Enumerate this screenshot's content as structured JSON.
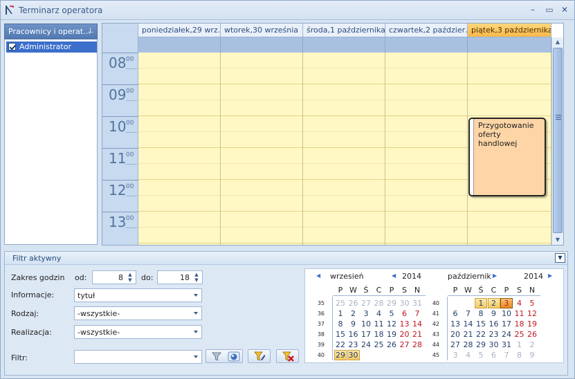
{
  "window": {
    "title": "Terminarz operatora"
  },
  "left_panel": {
    "header": "Pracownicy i operat…",
    "operators": [
      {
        "name": "Administrator",
        "checked": true
      }
    ]
  },
  "scheduler": {
    "days": [
      {
        "label": "poniedziałek,29 wrz…"
      },
      {
        "label": "wtorek,30 września"
      },
      {
        "label": "środa,1 października"
      },
      {
        "label": "czwartek,2 paździer…"
      },
      {
        "label": "piątek,3 października",
        "today": true
      }
    ],
    "hours": [
      "08",
      "09",
      "10",
      "11",
      "12",
      "13"
    ],
    "minutes_label": "00",
    "appointment": {
      "text": "Przygotowanie oferty handlowej",
      "day": "piątek,3 października"
    }
  },
  "filter": {
    "title": "Filtr aktywny",
    "hour_range_label": "Zakres godzin",
    "from_label": "od:",
    "from_value": "8",
    "to_label": "do:",
    "to_value": "18",
    "info_label": "Informacje:",
    "info_value": "tytuł",
    "type_label": "Rodzaj:",
    "type_value": "-wszystkie-",
    "realization_label": "Realizacja:",
    "realization_value": "-wszystkie-",
    "filter_label": "Filtr:",
    "filter_value": ""
  },
  "calendar": {
    "dow": [
      "P",
      "W",
      "Ś",
      "C",
      "P",
      "S",
      "N"
    ],
    "months": [
      {
        "name": "wrzesień",
        "year": "2014",
        "weeks": [
          {
            "wk": "35",
            "days": [
              {
                "d": "25",
                "g": true
              },
              {
                "d": "26",
                "g": true
              },
              {
                "d": "27",
                "g": true
              },
              {
                "d": "28",
                "g": true
              },
              {
                "d": "29",
                "g": true
              },
              {
                "d": "30",
                "g": true
              },
              {
                "d": "31",
                "g": true
              }
            ]
          },
          {
            "wk": "36",
            "days": [
              {
                "d": "1"
              },
              {
                "d": "2"
              },
              {
                "d": "3"
              },
              {
                "d": "4"
              },
              {
                "d": "5"
              },
              {
                "d": "6",
                "r": true
              },
              {
                "d": "7",
                "r": true
              }
            ]
          },
          {
            "wk": "37",
            "days": [
              {
                "d": "8"
              },
              {
                "d": "9"
              },
              {
                "d": "10"
              },
              {
                "d": "11"
              },
              {
                "d": "12"
              },
              {
                "d": "13",
                "r": true
              },
              {
                "d": "14",
                "r": true
              }
            ]
          },
          {
            "wk": "38",
            "days": [
              {
                "d": "15"
              },
              {
                "d": "16"
              },
              {
                "d": "17"
              },
              {
                "d": "18"
              },
              {
                "d": "19"
              },
              {
                "d": "20",
                "r": true
              },
              {
                "d": "21",
                "r": true
              }
            ]
          },
          {
            "wk": "39",
            "days": [
              {
                "d": "22"
              },
              {
                "d": "23"
              },
              {
                "d": "24"
              },
              {
                "d": "25"
              },
              {
                "d": "26"
              },
              {
                "d": "27",
                "r": true
              },
              {
                "d": "28",
                "r": true
              }
            ]
          },
          {
            "wk": "40",
            "days": [
              {
                "d": "29",
                "s": true
              },
              {
                "d": "30",
                "s": true
              }
            ]
          }
        ]
      },
      {
        "name": "październik",
        "year": "2014",
        "weeks": [
          {
            "wk": "40",
            "days": [
              {
                "d": ""
              },
              {
                "d": ""
              },
              {
                "d": "1",
                "s": true
              },
              {
                "d": "2",
                "s": true
              },
              {
                "d": "3",
                "c": true
              },
              {
                "d": "4",
                "r": true
              },
              {
                "d": "5",
                "r": true
              }
            ]
          },
          {
            "wk": "41",
            "days": [
              {
                "d": "6"
              },
              {
                "d": "7"
              },
              {
                "d": "8"
              },
              {
                "d": "9"
              },
              {
                "d": "10"
              },
              {
                "d": "11",
                "r": true
              },
              {
                "d": "12",
                "r": true
              }
            ]
          },
          {
            "wk": "42",
            "days": [
              {
                "d": "13"
              },
              {
                "d": "14"
              },
              {
                "d": "15"
              },
              {
                "d": "16"
              },
              {
                "d": "17"
              },
              {
                "d": "18",
                "r": true
              },
              {
                "d": "19",
                "r": true
              }
            ]
          },
          {
            "wk": "43",
            "days": [
              {
                "d": "20"
              },
              {
                "d": "21"
              },
              {
                "d": "22"
              },
              {
                "d": "23"
              },
              {
                "d": "24"
              },
              {
                "d": "25",
                "r": true
              },
              {
                "d": "26",
                "r": true
              }
            ]
          },
          {
            "wk": "44",
            "days": [
              {
                "d": "27"
              },
              {
                "d": "28"
              },
              {
                "d": "29"
              },
              {
                "d": "30"
              },
              {
                "d": "31"
              },
              {
                "d": "1",
                "g": true
              },
              {
                "d": "2",
                "g": true
              }
            ]
          },
          {
            "wk": "45",
            "days": [
              {
                "d": "3",
                "g": true
              },
              {
                "d": "4",
                "g": true
              },
              {
                "d": "5",
                "g": true
              },
              {
                "d": "6",
                "g": true
              },
              {
                "d": "7",
                "g": true
              },
              {
                "d": "8",
                "g": true
              },
              {
                "d": "9",
                "g": true
              }
            ]
          }
        ]
      }
    ]
  }
}
